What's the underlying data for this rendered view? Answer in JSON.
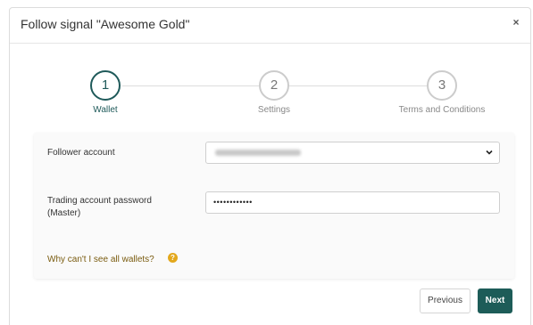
{
  "modal": {
    "title": "Follow signal \"Awesome Gold\"",
    "close_label": "×"
  },
  "stepper": {
    "steps": [
      {
        "number": "1",
        "label": "Wallet",
        "active": true
      },
      {
        "number": "2",
        "label": "Settings",
        "active": false
      },
      {
        "number": "3",
        "label": "Terms and Conditions",
        "active": false
      }
    ]
  },
  "form": {
    "follower_account_label": "Follower account",
    "trading_password_label_line1": "Trading account password",
    "trading_password_label_line2": "(Master)",
    "password_value": "••••••••••••",
    "why_link": "Why can't I see all wallets?",
    "help_icon": "?"
  },
  "buttons": {
    "previous": "Previous",
    "next": "Next"
  },
  "colors": {
    "accent": "#1d5c58",
    "link": "#7a5c10",
    "help_icon": "#e3a81c"
  }
}
